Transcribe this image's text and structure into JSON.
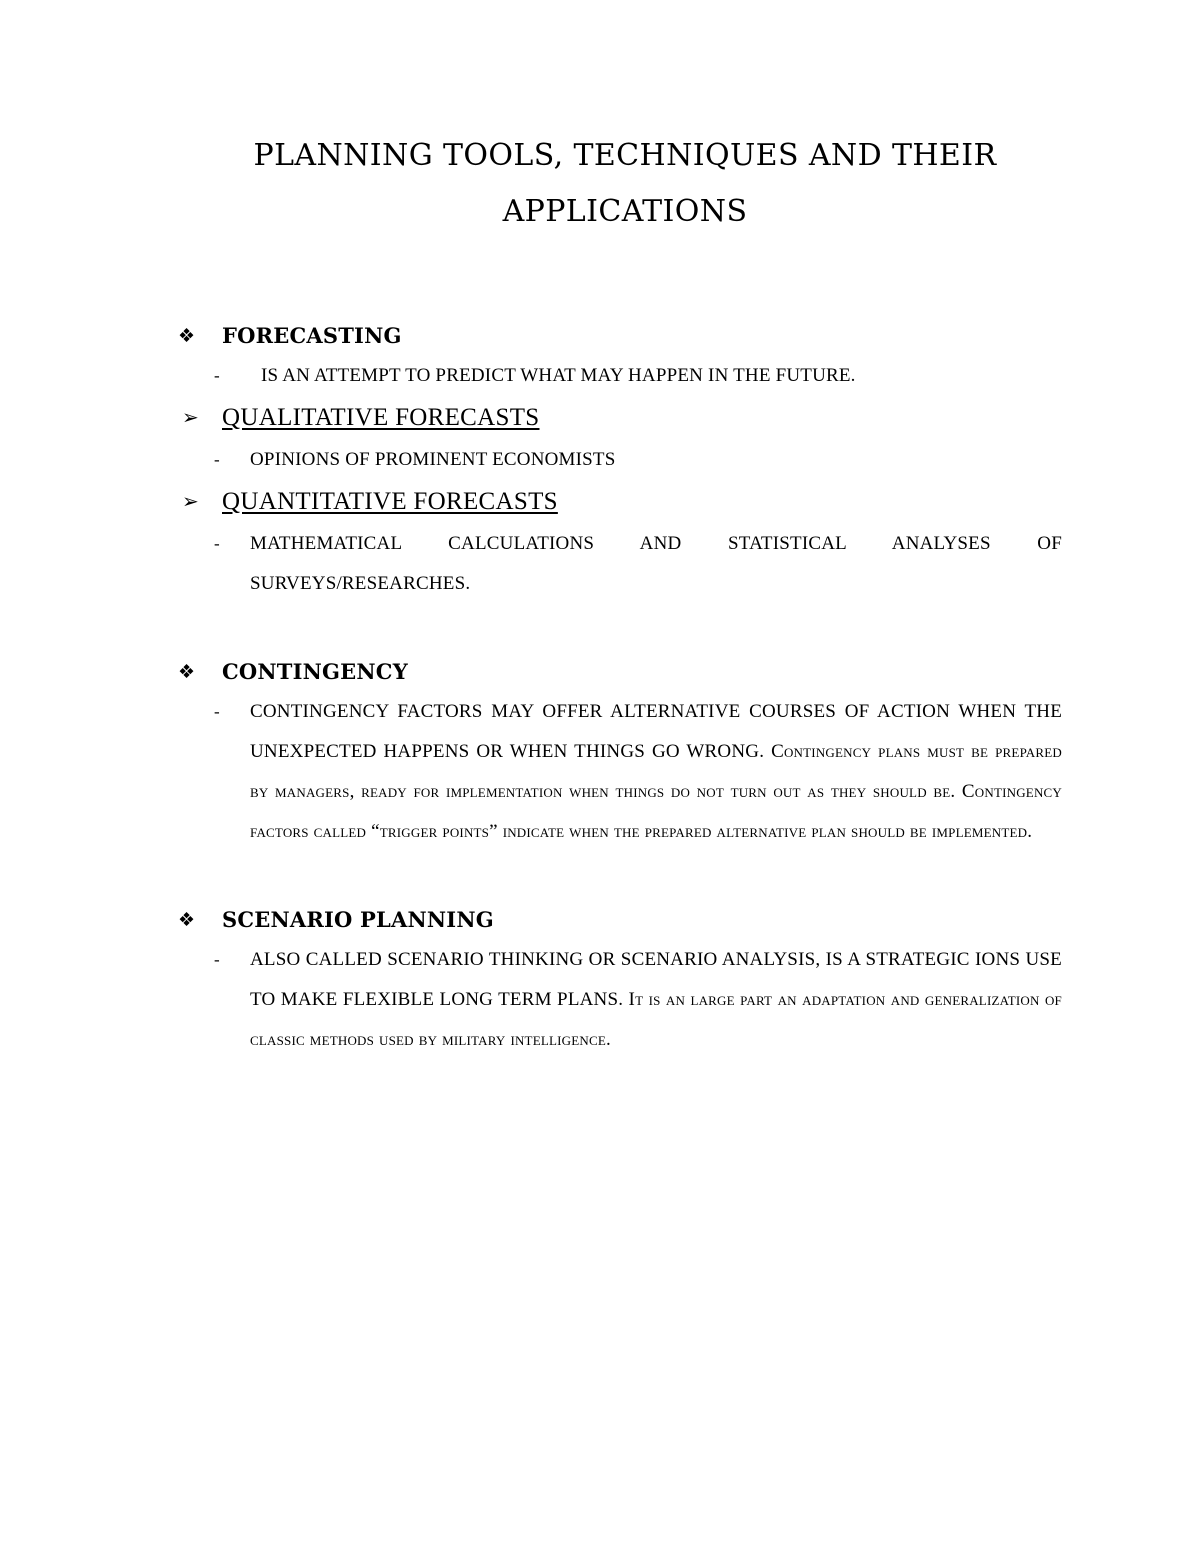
{
  "document": {
    "title_line1": "PLANNING TOOLS, TECHNIQUES AND THEIR",
    "title_line2": "APPLICATIONS"
  },
  "bullets": {
    "diamond": "❖",
    "arrow": "➢",
    "dash": "-"
  },
  "sections": [
    {
      "id": "forecasting",
      "heading": "FORECASTING",
      "items": [
        {
          "type": "dash",
          "text": "IS AN ATTEMPT TO PREDICT WHAT MAY HAPPEN IN THE FUTURE."
        },
        {
          "type": "arrow",
          "text": "QUALITATIVE FORECASTS"
        },
        {
          "type": "dash",
          "text": "OPINIONS OF PROMINENT ECONOMISTS"
        },
        {
          "type": "arrow",
          "text": "QUANTITATIVE FORECASTS"
        },
        {
          "type": "dash",
          "text": "MATHEMATICAL CALCULATIONS AND STATISTICAL ANALYSES OF SURVEYS/RESEARCHES."
        }
      ]
    },
    {
      "id": "contingency",
      "heading": "CONTINGENCY",
      "items": [
        {
          "type": "dash",
          "text": "CONTINGENCY FACTORS MAY OFFER ALTERNATIVE COURSES OF ACTION WHEN THE UNEXPECTED HAPPENS OR WHEN THINGS GO WRONG. Contingency plans must be prepared by managers, ready for implementation when things do not turn out as they should be. Contingency factors called “trigger points” indicate when the prepared alternative plan should be implemented."
        }
      ]
    },
    {
      "id": "scenario-planning",
      "heading": "SCENARIO PLANNING",
      "items": [
        {
          "type": "dash",
          "text": "ALSO CALLED SCENARIO THINKING OR SCENARIO ANALYSIS, IS A STRATEGIC IONS USE TO MAKE FLEXIBLE LONG TERM PLANS. It is an large part an adaptation and generalization of classic methods used by military intelligence."
        }
      ]
    }
  ],
  "colors": {
    "page_background": "#ffffff",
    "text": "#000000"
  }
}
